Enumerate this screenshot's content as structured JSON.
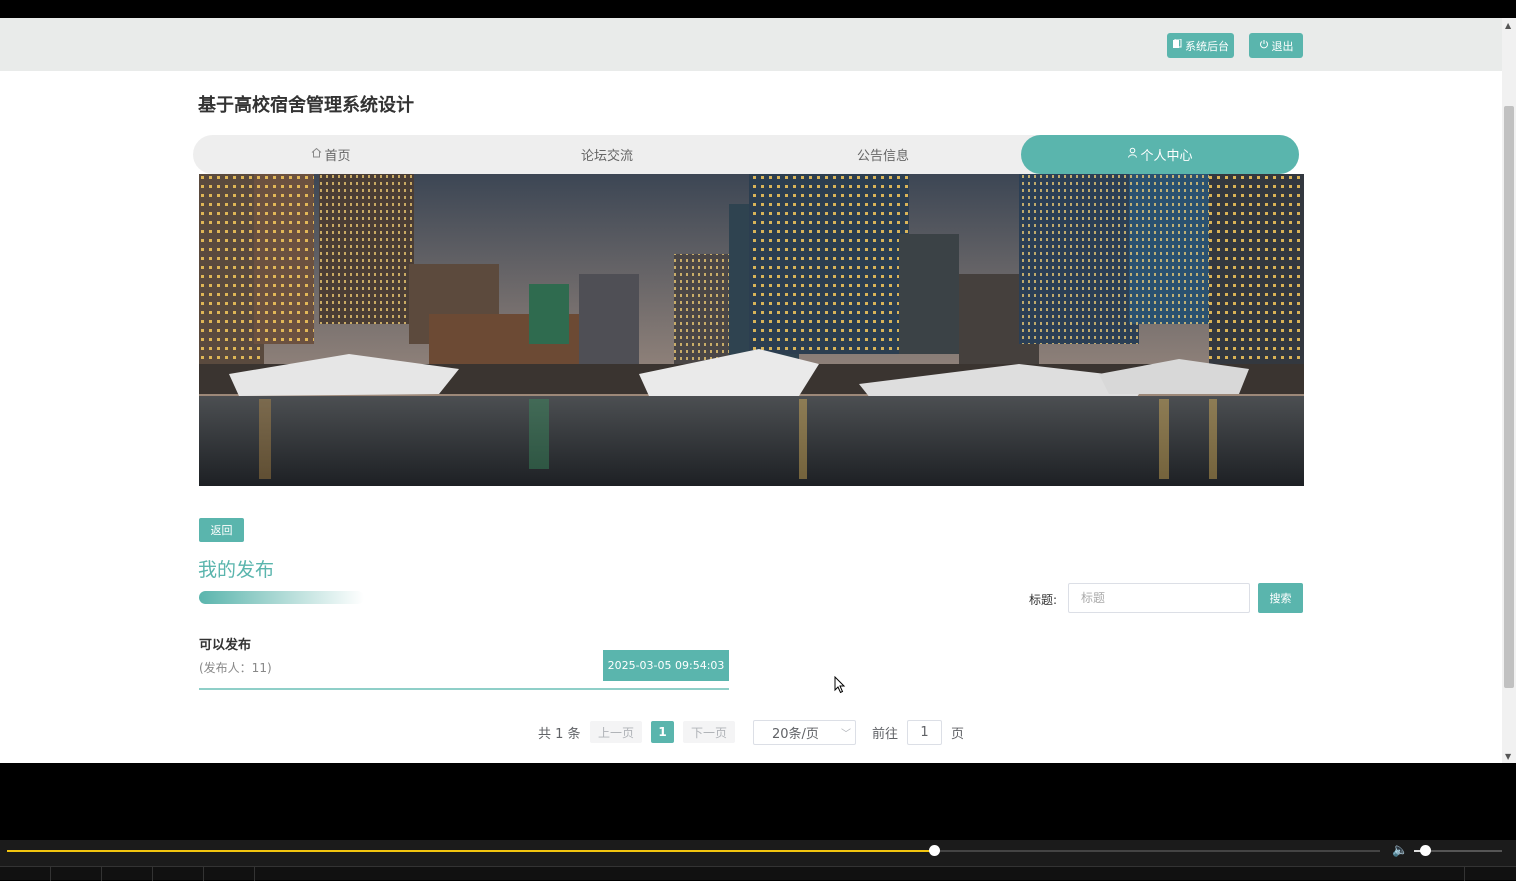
{
  "header": {
    "admin_label": "系统后台",
    "logout_label": "退出"
  },
  "site": {
    "title": "基于高校宿舍管理系统设计"
  },
  "nav": {
    "items": [
      {
        "label": "首页"
      },
      {
        "label": "论坛交流"
      },
      {
        "label": "公告信息"
      },
      {
        "label": "个人中心"
      }
    ],
    "active": "个人中心"
  },
  "page": {
    "back_label": "返回",
    "section_title": "我的发布"
  },
  "search": {
    "label": "标题:",
    "placeholder": "标题",
    "value": "",
    "button_label": "搜索"
  },
  "posts": [
    {
      "title": "可以发布",
      "author": "(发布人：11)",
      "date": "2025-03-05 09:54:03"
    }
  ],
  "pagination": {
    "total": "共 1 条",
    "prev_label": "上一页",
    "current_page": "1",
    "next_label": "下一页",
    "page_size": "20条/页",
    "goto_label": "前往",
    "goto_value": "1",
    "page_unit": "页"
  },
  "player": {
    "progress": 0.675,
    "volume": 0.1
  },
  "colors": {
    "accent": "#5ab5ad"
  }
}
